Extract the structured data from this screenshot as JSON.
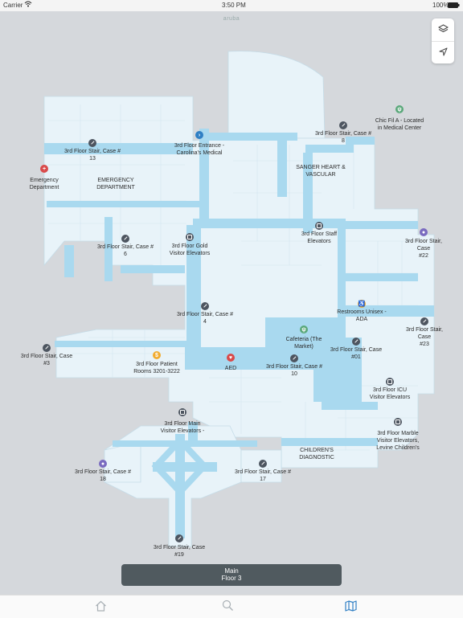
{
  "status_bar": {
    "carrier": "Carrier",
    "time": "3:50 PM",
    "battery": "100%"
  },
  "brand": "aruba",
  "colors": {
    "corridor": "#a9d9ef",
    "room": "#e8f3f9",
    "room_line": "#c5dce8",
    "background": "#d5d8dc",
    "accent": "#2f7fc4"
  },
  "map": {
    "areas": {
      "emergency": "EMERGENCY\nDEPARTMENT",
      "sanger": "SANGER HEART &\nVASCULAR",
      "childrens": "CHILDREN'S\nDIAGNOSTIC"
    },
    "pois": {
      "emergency_dept": "Emergency\nDepartment",
      "stair13": "3rd Floor Stair, Case #\n13",
      "entrance": "3rd Floor Entrance -\nCarolina's Medical",
      "stair8": "3rd Floor Stair, Case #\n8",
      "chicfila": "Chic Fil A - Located\nin Medical Center",
      "stair6": "3rd Floor Stair, Case #\n6",
      "gold_elev": "3rd Floor Gold\nVisitor Elevators",
      "staff_elev": "3rd Floor Staff\nElevators",
      "stair22": "3rd Floor Stair, Case\n#22",
      "stair4": "3rd Floor Stair, Case #\n4",
      "restrooms": "Restrooms Unisex -\nADA",
      "stair23": "3rd Floor Stair, Case\n#23",
      "cafeteria": "Cafeteria (The\nMarket)",
      "stair01": "3rd Floor Stair, Case\n#01",
      "stair3": "3rd Floor Stair, Case\n#3",
      "patient_rooms": "3rd Floor Patient\nRooms 3201-3222",
      "aed": "AED",
      "stair10": "3rd Floor Stair, Case #\n10",
      "icu_elev": "3rd Floor ICU\nVisitor Elevators",
      "main_elev": "3rd Floor Main\nVisitor Elevators -",
      "marble_elev": "3rd Floor Marble\nVisitor Elevators,\nLevine Children's",
      "stair18": "3rd Floor Stair, Case #\n18",
      "stair17": "3rd Floor Stair, Case #\n17",
      "stair19": "3rd Floor Stair, Case\n#19"
    }
  },
  "controls": {
    "layers_icon": "layers-icon",
    "locate_icon": "location-arrow-icon"
  },
  "floor_selector": {
    "building": "Main",
    "floor": "Floor 3"
  },
  "tabs": {
    "home_icon": "home-icon",
    "search_icon": "search-icon",
    "map_icon": "map-icon"
  }
}
